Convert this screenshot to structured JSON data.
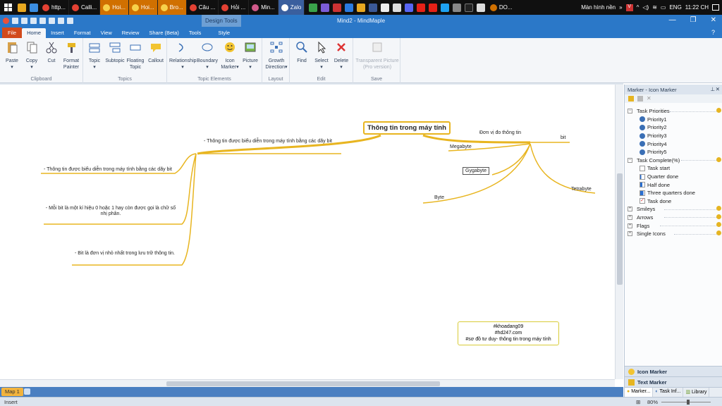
{
  "taskbar": {
    "tabs": [
      "http...",
      "Calli...",
      "Hoi...",
      "Hoi...",
      "Bro...",
      "Câu ...",
      "Hỏi ...",
      "Min...",
      "Zalo"
    ],
    "right_app": "DO...",
    "screen_label": "Màn hình nền",
    "lang": "ENG",
    "time": "11:22 CH"
  },
  "window": {
    "title": "Mind2 - MindMaple",
    "design_tools": "Design Tools"
  },
  "ribbon": {
    "tabs": [
      "File",
      "Home",
      "Insert",
      "Format",
      "View",
      "Review",
      "Share (Beta)",
      "Tools",
      "Style"
    ],
    "groups": {
      "clipboard": {
        "label": "Clipboard",
        "buttons": [
          "Paste",
          "Copy",
          "Cut",
          "Format\nPainter"
        ]
      },
      "topics": {
        "label": "Topics",
        "buttons": [
          "Topic",
          "Subtopic",
          "Floating\nTopic",
          "Callout"
        ]
      },
      "topic_elements": {
        "label": "Topic Elements",
        "buttons": [
          "Relationship",
          "Boundary",
          "Icon\nMarker",
          "Picture"
        ]
      },
      "layout": {
        "label": "Layout",
        "buttons": [
          "Growth\nDirection"
        ]
      },
      "edit": {
        "label": "Edit",
        "buttons": [
          "Find",
          "Select",
          "Delete"
        ]
      },
      "save": {
        "label": "Save",
        "buttons": [
          "Transparent Picture\n(Pro version)"
        ]
      }
    }
  },
  "map": {
    "root": "Thông tin trong máy tính",
    "left_branch": "- Thông tin được biểu diễn trong máy tính bằng các dãy bit",
    "left_children": [
      "- Thông tin được biểu diễn trong máy tính bằng các dãy bit",
      "- Mỗi bit là một kí hiệu 0 hoặc 1 hay còn được gọi là chữ số nhị phân.",
      "- Bit là đơn vị nhỏ nhất trong lưu trữ thông tin."
    ],
    "right_branch": "Đơn vị đo thông tin",
    "right_children": [
      "bit",
      "Megabyte",
      "Gygabyte",
      "Tetrabyte",
      "Byte"
    ],
    "note_lines": [
      "#khoadang09",
      "#hd247.com",
      "#sơ đồ tư duy- thông tin trong máy tính"
    ]
  },
  "panel": {
    "title": "Marker - Icon Marker",
    "groups": [
      {
        "label": "Task Priorities",
        "expanded": true,
        "items": [
          "Priority1",
          "Priority2",
          "Priority3",
          "Priority4",
          "Priority5"
        ]
      },
      {
        "label": "Task Complete(%)",
        "expanded": true,
        "items": [
          "Task start",
          "Quarter done",
          "Half done",
          "Three quarters done",
          "Task done"
        ]
      },
      {
        "label": "Smileys",
        "expanded": false,
        "items": []
      },
      {
        "label": "Arrows",
        "expanded": false,
        "items": []
      },
      {
        "label": "Flags",
        "expanded": false,
        "items": []
      },
      {
        "label": "Single Icons",
        "expanded": false,
        "items": []
      }
    ],
    "footer": [
      "Icon Marker",
      "Text Marker"
    ],
    "bottom_tabs": [
      "Marker...",
      "Task Inf...",
      "Library"
    ]
  },
  "status": {
    "mode": "Insert",
    "zoom": "80%",
    "map_tab": "Map 1"
  },
  "colors": {
    "accent": "#2b78c8",
    "branch": "#e8b520",
    "file_tab": "#d24a1c"
  }
}
